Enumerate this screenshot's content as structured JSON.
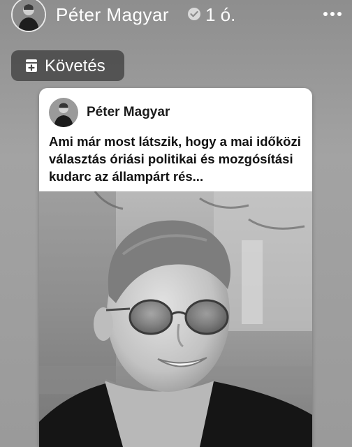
{
  "story": {
    "author_name": "Péter Magyar",
    "post_age": "1 ó."
  },
  "follow_button": {
    "label": "Követés"
  },
  "post": {
    "author_name": "Péter Magyar",
    "text": "Ami már most látszik, hogy a mai időközi választás óriási politikai és mozgósítási kudarc az állampárt rés..."
  },
  "colors": {
    "verified_badge": "#d9d9d9",
    "follow_bg": "#464646"
  },
  "icons": {
    "verified": "verified-badge-icon",
    "more": "more-options-icon",
    "follow": "follow-icon"
  }
}
